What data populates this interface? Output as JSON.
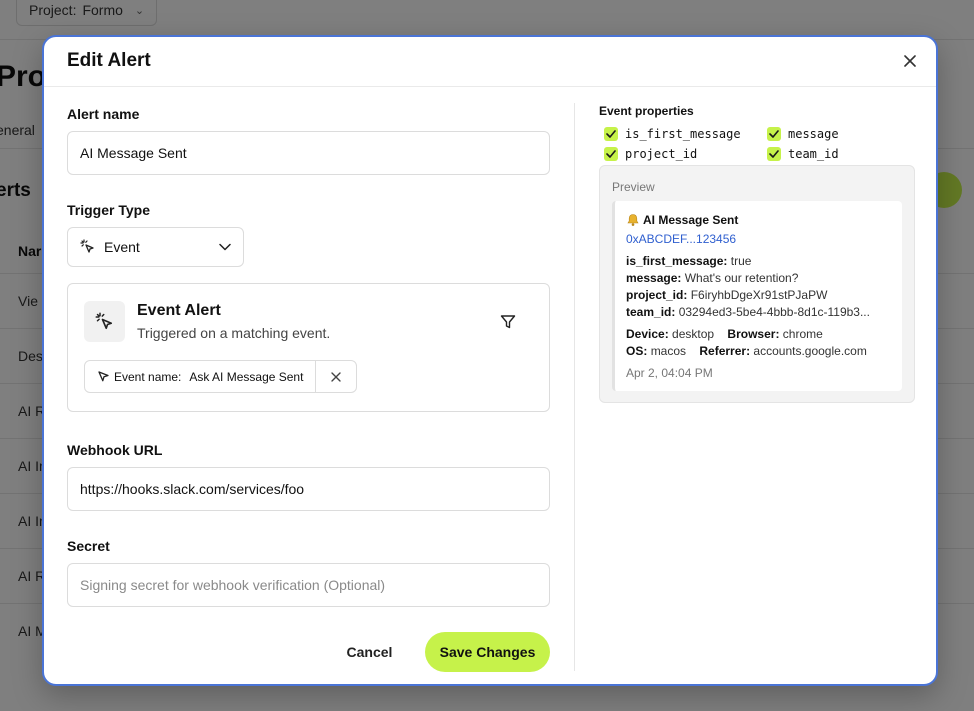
{
  "background": {
    "project_label": "Project:",
    "project_name": "Formo",
    "page_title": "Proj",
    "tab_general": "eneral",
    "section_title": "erts",
    "column_header": "Nar",
    "rows": [
      "Vie",
      "Des",
      "AI R",
      "AI In",
      "AI In",
      "AI R",
      "AI M"
    ]
  },
  "modal": {
    "title": "Edit Alert",
    "close_icon": "close-icon",
    "alert_name": {
      "label": "Alert name",
      "value": "AI Message Sent"
    },
    "trigger_type": {
      "label": "Trigger Type",
      "selected": "Event",
      "icon": "cursor-click-icon"
    },
    "event_card": {
      "title": "Event Alert",
      "subtitle": "Triggered on a matching event.",
      "chip_key": "Event name:",
      "chip_value": "Ask AI Message Sent"
    },
    "webhook": {
      "label": "Webhook URL",
      "value": "https://hooks.slack.com/services/foo"
    },
    "secret": {
      "label": "Secret",
      "placeholder": "Signing secret for webhook verification (Optional)"
    },
    "buttons": {
      "cancel": "Cancel",
      "save": "Save Changes"
    },
    "event_properties": {
      "label": "Event properties",
      "items": [
        {
          "name": "is_first_message",
          "checked": true
        },
        {
          "name": "message",
          "checked": true
        },
        {
          "name": "project_id",
          "checked": true
        },
        {
          "name": "team_id",
          "checked": true
        }
      ]
    },
    "preview": {
      "label": "Preview",
      "title": "AI Message Sent",
      "address": "0xABCDEF...123456",
      "fields": [
        {
          "key": "is_first_message:",
          "value": "true"
        },
        {
          "key": "message:",
          "value": "What's our retention?"
        },
        {
          "key": "project_id:",
          "value": "F6iryhbDgeXr91stPJaPW"
        },
        {
          "key": "team_id:",
          "value": "03294ed3-5be4-4bbb-8d1c-119b3..."
        }
      ],
      "meta": [
        {
          "key": "Device:",
          "value": "desktop"
        },
        {
          "key": "Browser:",
          "value": "chrome"
        },
        {
          "key": "OS:",
          "value": "macos"
        },
        {
          "key": "Referrer:",
          "value": "accounts.google.com"
        }
      ],
      "timestamp": "Apr 2, 04:04 PM"
    }
  },
  "colors": {
    "accent": "#c6f24a",
    "modal_border": "#4a74d6",
    "link": "#2f5fcf"
  }
}
